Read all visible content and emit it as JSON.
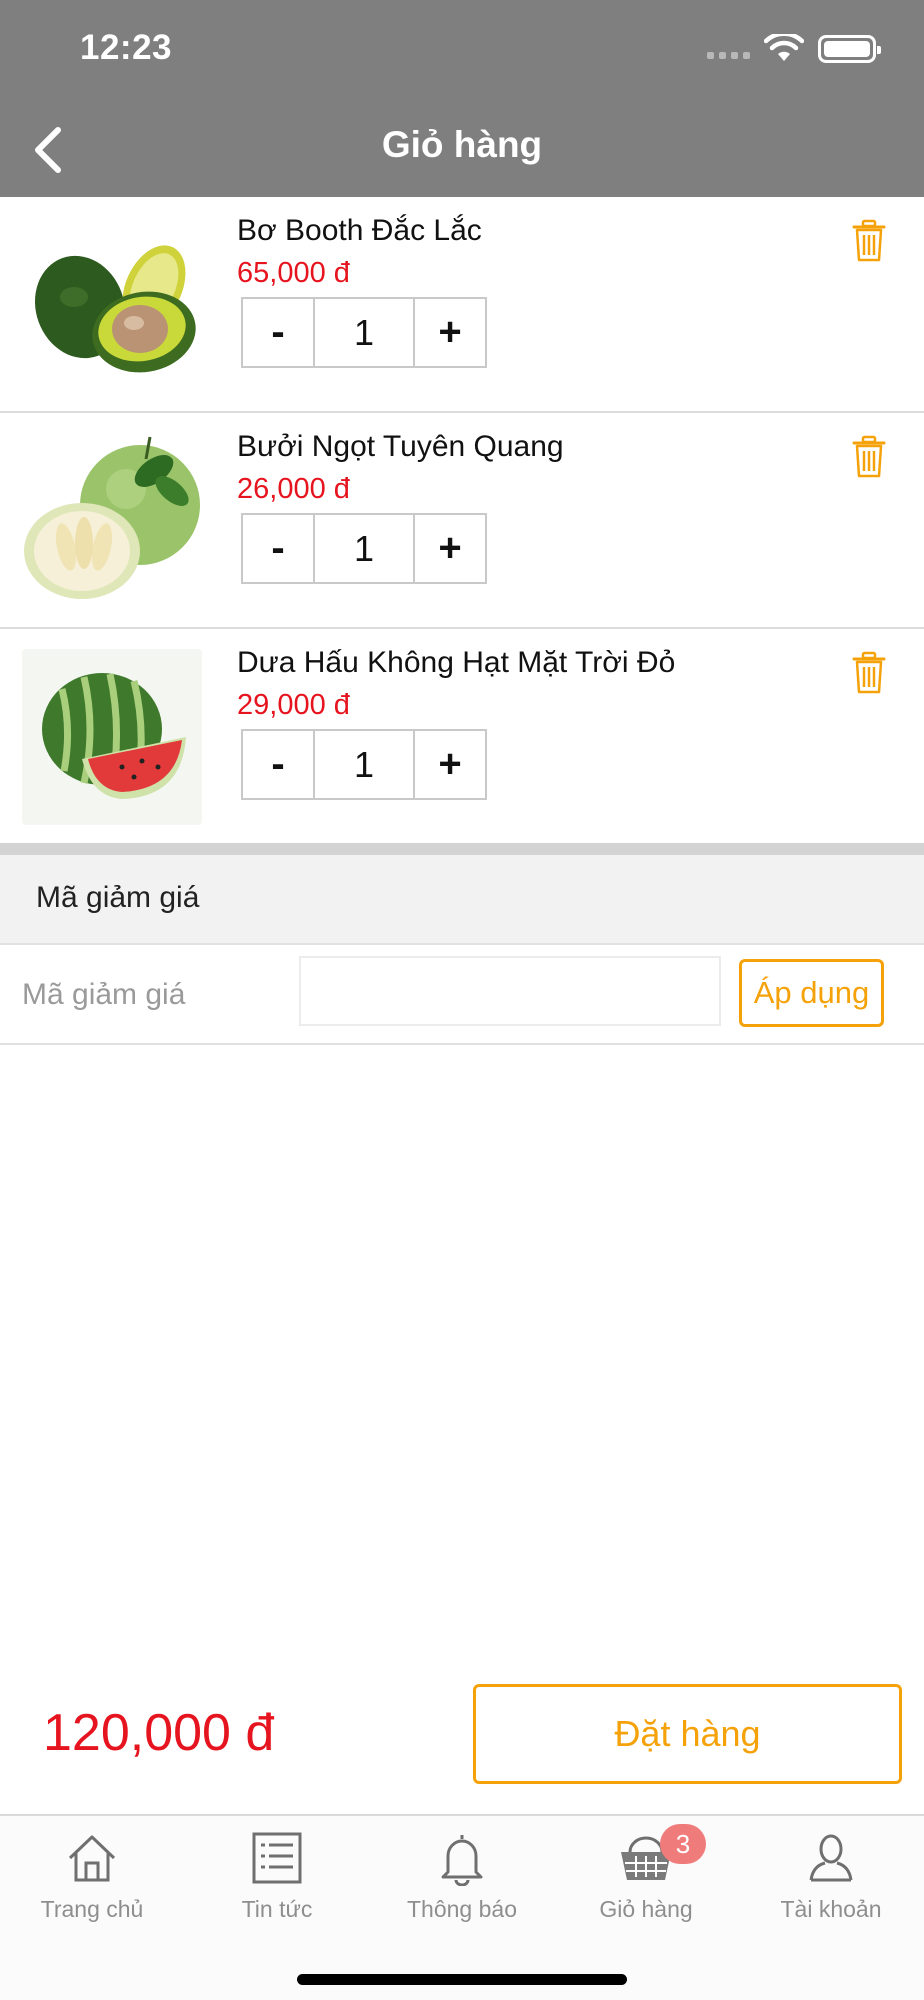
{
  "status_bar": {
    "time": "12:23"
  },
  "header": {
    "title": "Giỏ hàng"
  },
  "cart_items": [
    {
      "name": "Bơ Booth Đắc Lắc",
      "price": "65,000 đ",
      "quantity": "1"
    },
    {
      "name": "Bưởi Ngọt Tuyên Quang",
      "price": "26,000 đ",
      "quantity": "1"
    },
    {
      "name": "Dưa Hấu Không Hạt Mặt Trời Đỏ",
      "price": "29,000 đ",
      "quantity": "1"
    }
  ],
  "qty_controls": {
    "minus": "-",
    "plus": "+"
  },
  "discount": {
    "section_title": "Mã giảm giá",
    "label": "Mã giảm giá",
    "input_value": "",
    "apply_label": "Áp dụng"
  },
  "summary": {
    "total": "120,000 đ",
    "order_label": "Đặt hàng"
  },
  "tabbar": {
    "items": [
      {
        "label": "Trang chủ",
        "icon": "home-icon"
      },
      {
        "label": "Tin tức",
        "icon": "news-list-icon"
      },
      {
        "label": "Thông báo",
        "icon": "bell-icon"
      },
      {
        "label": "Giỏ hàng",
        "icon": "basket-icon",
        "badge": "3"
      },
      {
        "label": "Tài khoản",
        "icon": "user-icon"
      }
    ]
  },
  "colors": {
    "header": "#7f7f7f",
    "accent": "#f5a20a",
    "price": "#e6141e",
    "badge": "#f07b7b"
  }
}
